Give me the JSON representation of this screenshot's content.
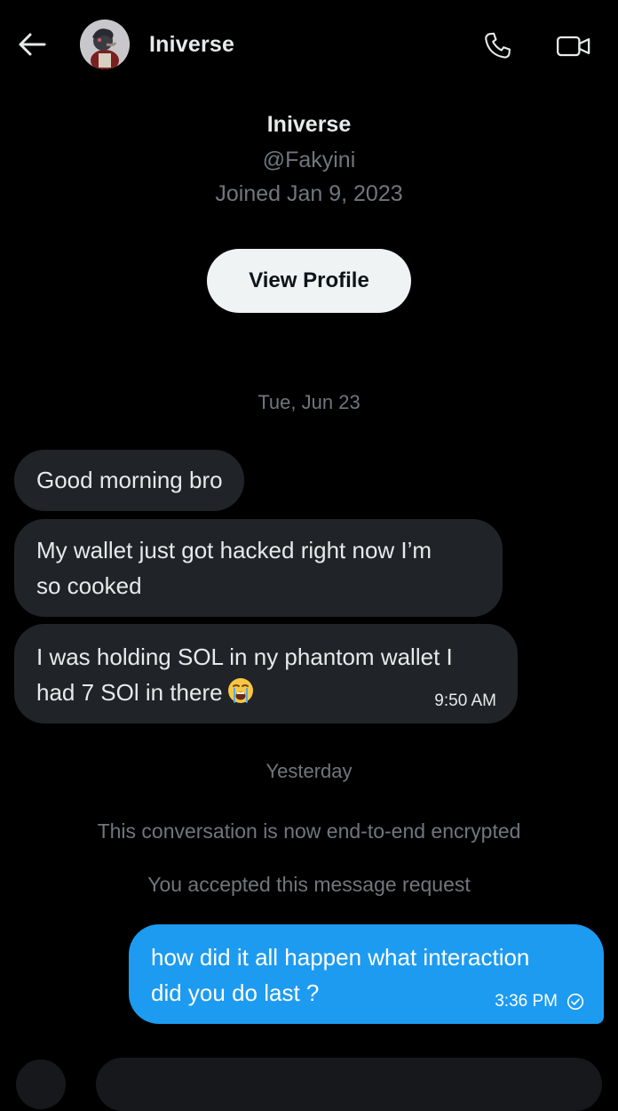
{
  "colors": {
    "background": "#000000",
    "incoming_bubble": "#202327",
    "outgoing_bubble": "#1d9bf0",
    "muted_text": "#71767b",
    "primary_text": "#e7e9ea"
  },
  "header": {
    "back_icon": "arrow-left-icon",
    "name": "Iniverse",
    "call_icon": "phone-icon",
    "video_icon": "video-camera-icon"
  },
  "profile": {
    "name": "Iniverse",
    "handle": "@Fakyini",
    "joined": "Joined Jan 9, 2023",
    "view_profile_label": "View Profile"
  },
  "conversation": {
    "date_1": "Tue, Jun 23",
    "incoming": [
      {
        "line1": "Good morning bro"
      },
      {
        "line1": "My wallet just got hacked right now I’m",
        "line2": "so cooked"
      },
      {
        "line1": "I was holding SOL in ny phantom wallet I",
        "line2": "had 7 SOl in there",
        "emoji": "loudly-crying-face-emoji",
        "time": "9:50 AM"
      }
    ],
    "date_2": "Yesterday",
    "system_1": "This conversation is now end-to-end encrypted",
    "system_2": "You accepted this message request",
    "outgoing": {
      "line1": "how did it all happen what interaction",
      "line2": "did you do last ?",
      "time": "3:36 PM",
      "status_icon": "sent-check-icon"
    }
  }
}
